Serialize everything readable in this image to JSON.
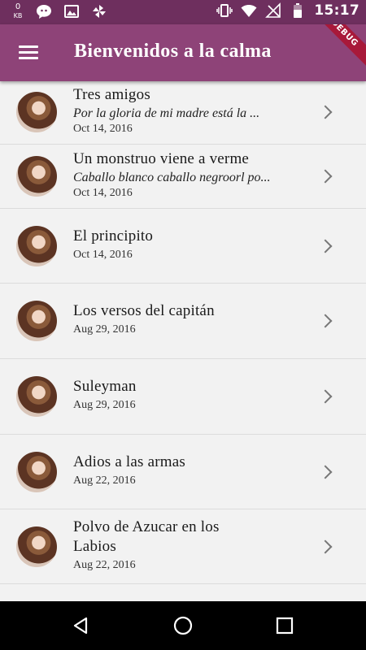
{
  "status_bar": {
    "kb_value": "0",
    "kb_unit": "KB",
    "time": "15:17"
  },
  "app_bar": {
    "title": "Bienvenidos a la calma",
    "debug_label": "DEBUG",
    "menu_icon": "menu-icon"
  },
  "colors": {
    "status_bar": "#6e2f5e",
    "app_bar": "#8e4378",
    "background": "#f2f2f2"
  },
  "items": [
    {
      "title": "Tres amigos",
      "subtitle": "Por la gloria de mi madre está la ...",
      "date": "Oct 14, 2016"
    },
    {
      "title": "Un monstruo viene a verme",
      "subtitle": "Caballo blanco caballo negroorl po...",
      "date": "Oct 14, 2016"
    },
    {
      "title": "El principito",
      "subtitle": "",
      "date": "Oct 14, 2016"
    },
    {
      "title": "Los versos del capitán",
      "subtitle": "",
      "date": "Aug 29, 2016"
    },
    {
      "title": "Suleyman",
      "subtitle": "",
      "date": "Aug 29, 2016"
    },
    {
      "title": "Adios a las armas",
      "subtitle": "",
      "date": "Aug 22, 2016"
    },
    {
      "title": "Polvo de Azucar en los Labios",
      "subtitle": "",
      "date": "Aug 22, 2016"
    }
  ],
  "nav_bar": {
    "back_icon": "back-triangle-icon",
    "home_icon": "home-circle-icon",
    "recent_icon": "recent-apps-square-icon"
  }
}
